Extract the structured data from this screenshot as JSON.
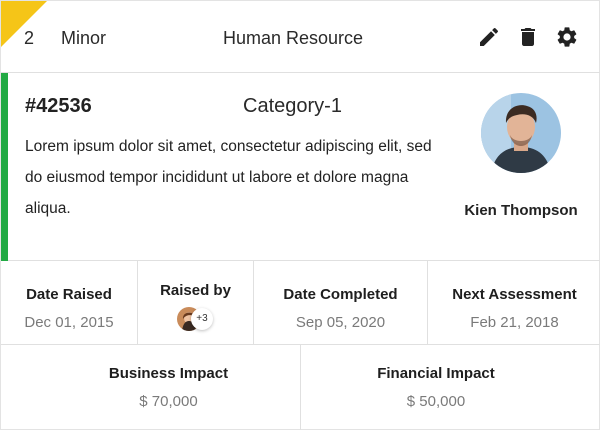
{
  "header": {
    "number": "2",
    "severity": "Minor",
    "department": "Human Resource",
    "actions": [
      {
        "icon": "pencil-icon",
        "label": "edit"
      },
      {
        "icon": "trash-icon",
        "label": "delete"
      },
      {
        "icon": "gear-icon",
        "label": "settings"
      }
    ],
    "corner_color": "#f5c518"
  },
  "ticket": {
    "id": "#42536",
    "category": "Category-1",
    "description": "Lorem ipsum dolor sit amet, consectetur adipiscing elit, sed do eiusmod tempor incididunt ut labore et dolore magna aliqua.",
    "accent_color": "#22aa44",
    "owner_name": "Kien Thompson"
  },
  "details": {
    "date_raised": {
      "label": "Date Raised",
      "value": "Dec 01, 2015"
    },
    "raised_by": {
      "label": "Raised by",
      "more_count": "+3"
    },
    "date_completed": {
      "label": "Date Completed",
      "value": "Sep 05, 2020"
    },
    "next_assessment": {
      "label": "Next Assessment",
      "value": "Feb 21, 2018"
    }
  },
  "impact": {
    "business": {
      "label": "Business Impact",
      "value": "$ 70,000"
    },
    "financial": {
      "label": "Financial Impact",
      "value": "$ 50,000"
    }
  }
}
